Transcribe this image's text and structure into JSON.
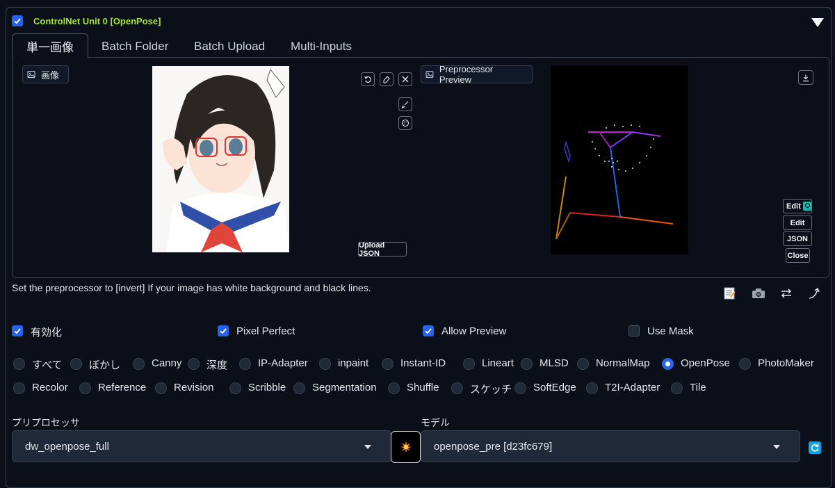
{
  "unit": {
    "title": "ControlNet Unit 0  [OpenPose]",
    "enabled": true
  },
  "tabs": [
    {
      "label": "単一画像",
      "active": true
    },
    {
      "label": "Batch Folder",
      "active": false
    },
    {
      "label": "Batch Upload",
      "active": false
    },
    {
      "label": "Multi-Inputs",
      "active": false
    }
  ],
  "image_panel": {
    "label": "画像",
    "tools": [
      "undo-icon",
      "eraser-icon",
      "close-icon",
      "brush-icon",
      "palette-icon"
    ],
    "upload_json_label": "Upload JSON"
  },
  "preview_panel": {
    "label": "Preprocessor Preview",
    "buttons": {
      "edit_photopea": "Edit",
      "edit": "Edit",
      "json": "JSON",
      "close": "Close"
    }
  },
  "note": "Set the preprocessor to [invert] If your image has white background and black lines.",
  "action_icons": [
    "memo-icon",
    "camera-icon",
    "swap-icon",
    "send-arrow-icon"
  ],
  "checkboxes": {
    "enable": {
      "label": "有効化",
      "checked": true
    },
    "pixel_perfect": {
      "label": "Pixel Perfect",
      "checked": true
    },
    "allow_preview": {
      "label": "Allow Preview",
      "checked": true
    },
    "use_mask": {
      "label": "Use Mask",
      "checked": false
    }
  },
  "control_types": {
    "row1": [
      "すべて",
      "ぼかし",
      "Canny",
      "深度",
      "IP-Adapter",
      "inpaint",
      "Instant-ID",
      "Lineart",
      "MLSD",
      "NormalMap",
      "OpenPose",
      "PhotoMaker"
    ],
    "row2": [
      "Recolor",
      "Reference",
      "Revision",
      "Scribble",
      "Segmentation",
      "Shuffle",
      "スケッチ",
      "SoftEdge",
      "T2I-Adapter",
      "Tile"
    ],
    "selected": "OpenPose"
  },
  "preprocessor": {
    "label": "プリプロセッサ",
    "value": "dw_openpose_full"
  },
  "model": {
    "label": "モデル",
    "value": "openpose_pre [d23fc679]"
  },
  "colors": {
    "accent": "#2563eb",
    "title_green": "#a3e635",
    "background": "#0b0f19"
  }
}
